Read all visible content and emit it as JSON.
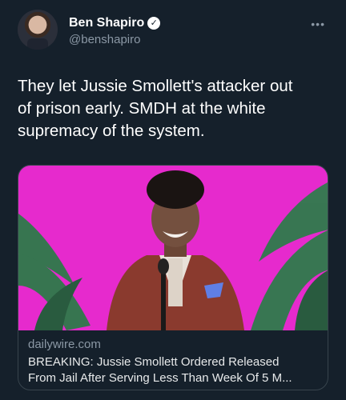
{
  "author": {
    "display_name": "Ben Shapiro",
    "handle": "@benshapiro",
    "verified_icon": "verified-badge-icon",
    "avatar_icon": "profile-photo"
  },
  "menu": {
    "more_label": "•••"
  },
  "tweet": {
    "text": "They let Jussie Smollett's attacker out\nof prison early. SMDH at the white\nsupremacy of the system."
  },
  "link_card": {
    "domain": "dailywire.com",
    "title_line1": "BREAKING: Jussie Smollett Ordered Released",
    "title_line2": "From Jail After Serving Less Than Week Of 5 M..."
  },
  "colors": {
    "background": "#15202b",
    "secondary_text": "#8b98a5",
    "card_border": "#38444d",
    "image_backdrop": "#e020c8"
  }
}
